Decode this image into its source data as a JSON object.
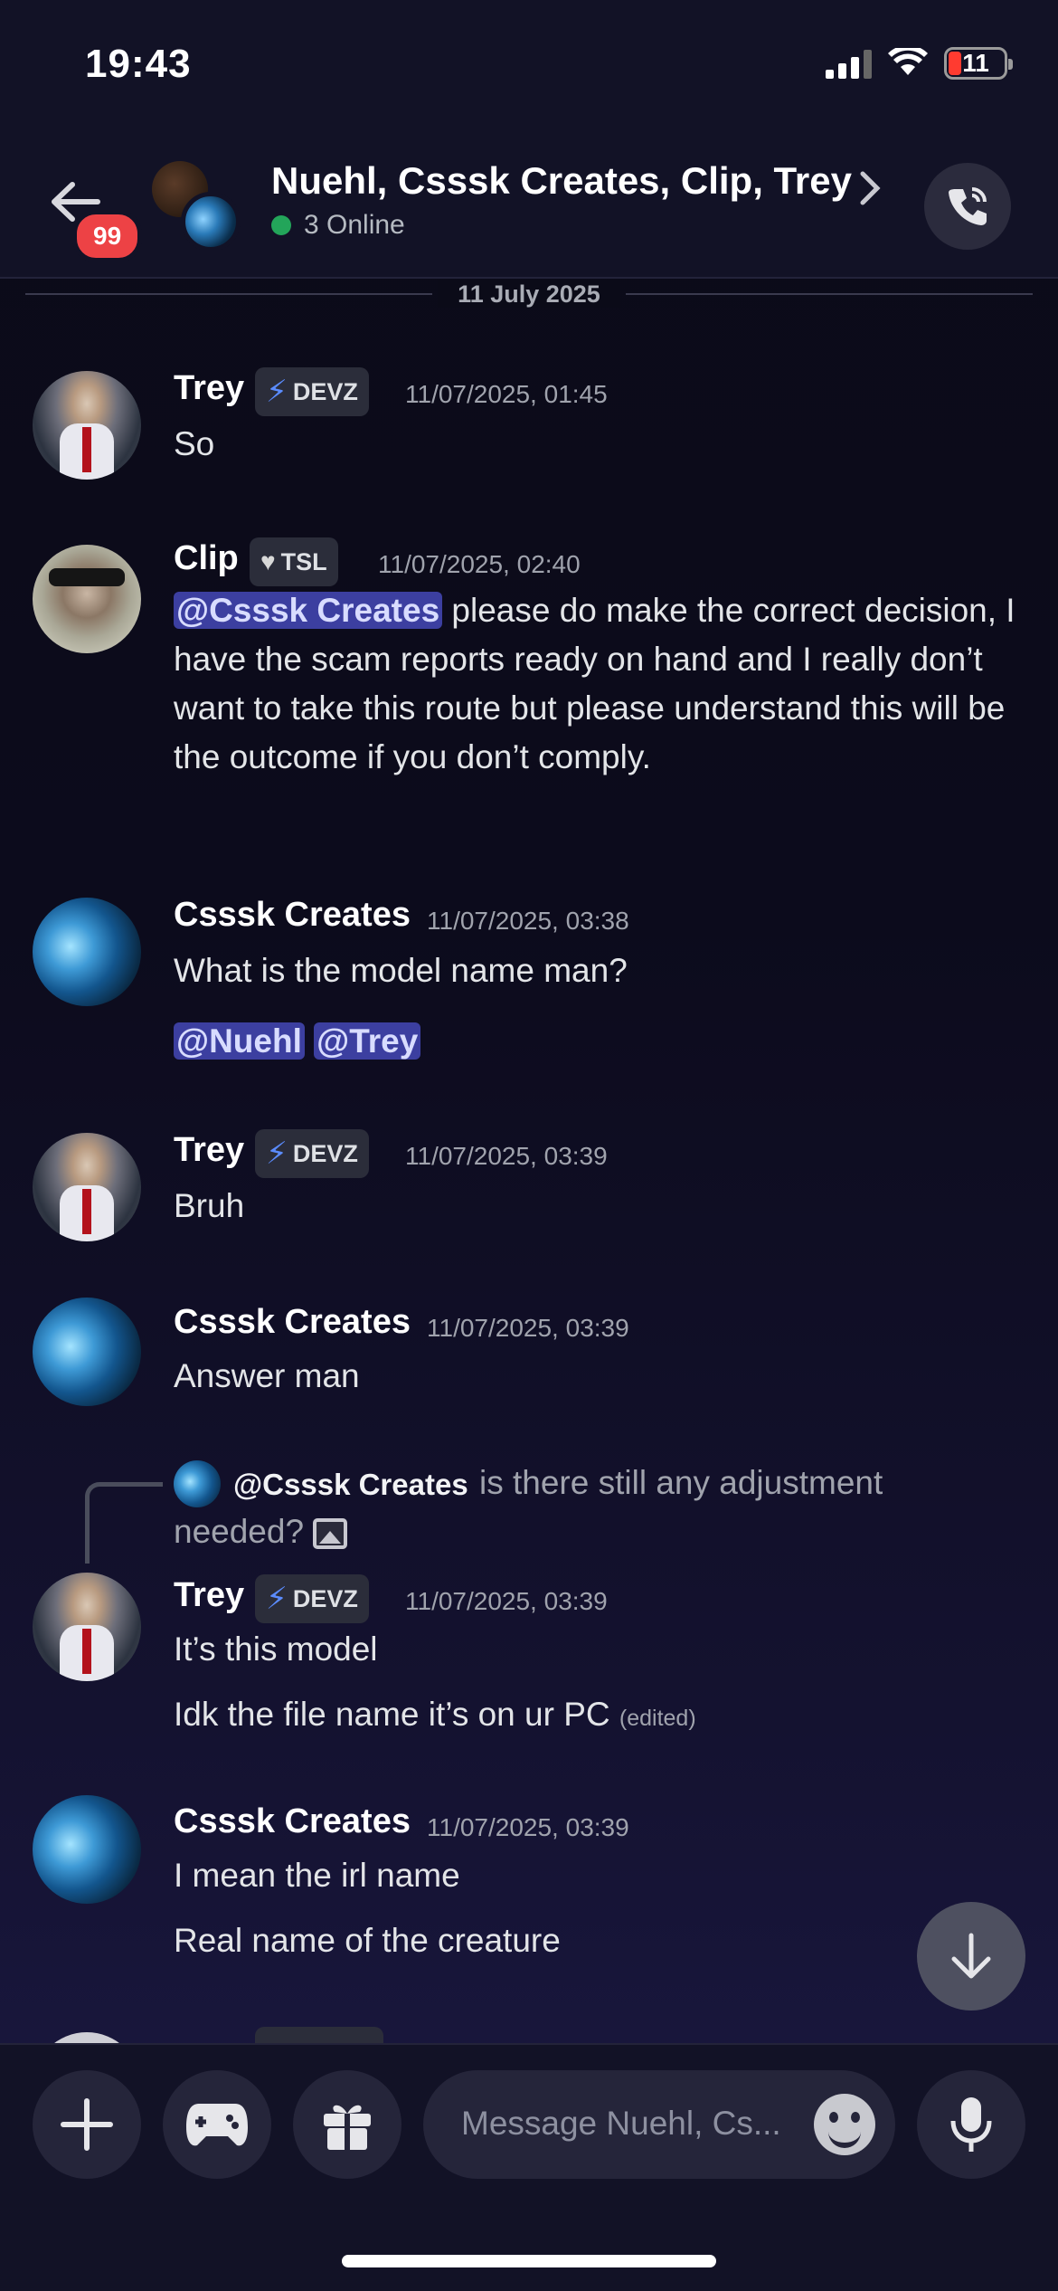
{
  "status_bar": {
    "time": "19:43",
    "battery_level": "11"
  },
  "header": {
    "badge_count": "99",
    "title": "Nuehl, Csssk Creates, Clip, Trey",
    "status": "3 Online"
  },
  "date_divider": "11 July 2025",
  "messages": [
    {
      "author": "Trey",
      "tag": "DEVZ",
      "time": "11/07/2025, 01:45",
      "lines": [
        "So"
      ]
    },
    {
      "author": "Clip",
      "tag": "TSL",
      "time": "11/07/2025, 02:40",
      "mention": "@Csssk Creates",
      "text": " please do make the correct decision, I have the scam reports ready on hand and I really don’t want to take this route but please understand this will be the outcome if you don’t comply."
    },
    {
      "author": "Csssk Creates",
      "time": "11/07/2025, 03:38",
      "lines": [
        "What is the model name man?"
      ],
      "mentions": [
        "@Nuehl",
        "@Trey"
      ]
    },
    {
      "author": "Trey",
      "tag": "DEVZ",
      "time": "11/07/2025, 03:39",
      "lines": [
        "Bruh"
      ]
    },
    {
      "author": "Csssk Creates",
      "time": "11/07/2025, 03:39",
      "lines": [
        "Answer man"
      ]
    },
    {
      "reply": {
        "author": "@Csssk Creates",
        "text": "is there still any adjustment needed?"
      },
      "author": "Trey",
      "tag": "DEVZ",
      "time": "11/07/2025, 03:39",
      "lines": [
        "It’s this model",
        "Idk the file name it’s on ur PC"
      ],
      "edited": "(edited)"
    },
    {
      "author": "Csssk Creates",
      "time": "11/07/2025, 03:39",
      "lines": [
        "I mean the irl name",
        "Real name of the creature"
      ]
    }
  ],
  "composer": {
    "placeholder": "Message Nuehl, Cs..."
  },
  "icons": {
    "back": "arrow-left-icon",
    "call": "phone-icon",
    "scroll": "arrow-down-icon",
    "add": "plus-icon",
    "games": "gamepad-icon",
    "gift": "gift-icon",
    "emoji": "emoji-icon",
    "mic": "microphone-icon",
    "image": "image-icon"
  },
  "colors": {
    "online": "#23a55a",
    "badge": "#ed4245",
    "mention_bg": "#3c3fa0",
    "devz_bolt": "#5b8cff"
  }
}
